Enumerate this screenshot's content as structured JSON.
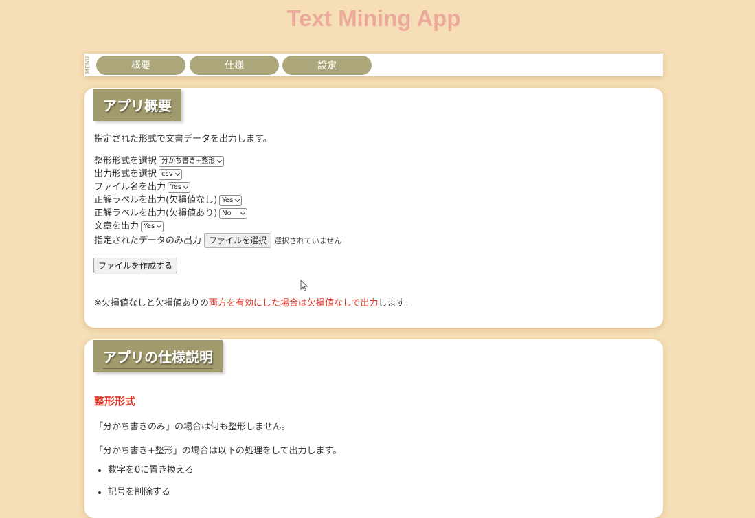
{
  "app": {
    "title": "Text Mining App"
  },
  "menu": {
    "label": "MENU",
    "items": [
      {
        "label": "概要"
      },
      {
        "label": "仕様"
      },
      {
        "label": "設定"
      }
    ]
  },
  "overview": {
    "heading": "アプリ概要",
    "intro": "指定された形式で文書データを出力します。",
    "fields": [
      {
        "label": "整形形式を選択",
        "value": "分かち書き+整形"
      },
      {
        "label": "出力形式を選択",
        "value": "csv"
      },
      {
        "label": "ファイル名を出力",
        "value": "Yes"
      },
      {
        "label": "正解ラベルを出力(欠損値なし)",
        "value": "Yes"
      },
      {
        "label": "正解ラベルを出力(欠損値あり)",
        "value": "No"
      },
      {
        "label": "文章を出力",
        "value": "Yes"
      }
    ],
    "file_field": {
      "label": "指定されたデータのみ出力",
      "button_label": "ファイルを選択",
      "status": "選択されていません"
    },
    "create_button_label": "ファイルを作成する",
    "note": {
      "prefix": "※欠損値なしと欠損値ありの",
      "highlight": "両方を有効にした場合は欠損値なしで出力",
      "suffix": "します。"
    }
  },
  "spec": {
    "heading": "アプリの仕様説明",
    "subheading": "整形形式",
    "paragraphs": [
      "「分かち書きのみ」の場合は何も整形しません。",
      "「分かち書き+整形」の場合は以下の処理をして出力します。"
    ],
    "bullets": [
      "数字を0に置き換える",
      "記号を削除する"
    ]
  },
  "colors": {
    "background": "#f6dfb7",
    "title": "#eba99c",
    "accent": "#a09a6c",
    "highlight": "#e0392b"
  }
}
